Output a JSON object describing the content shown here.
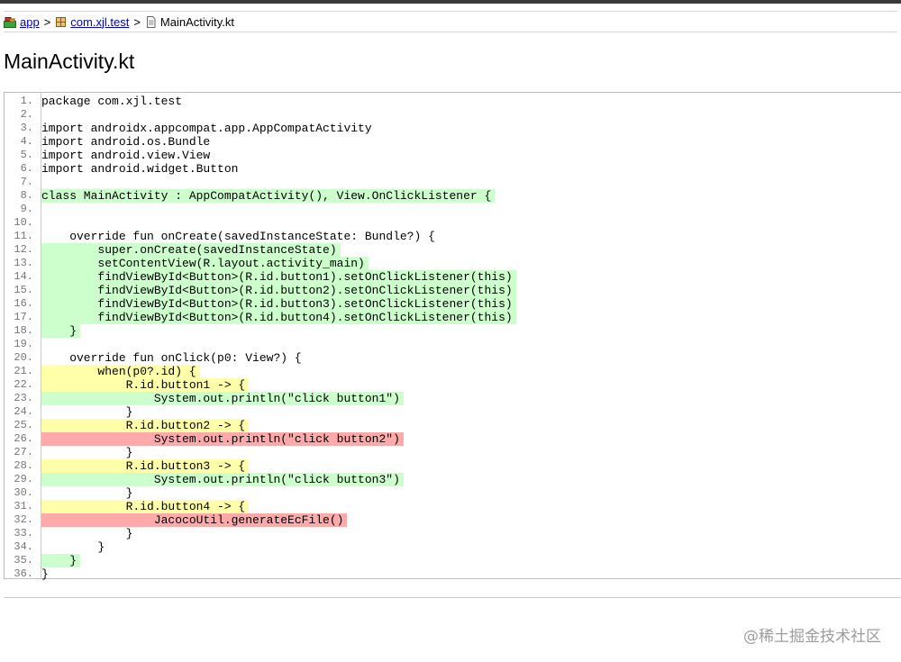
{
  "breadcrumb": {
    "items": [
      {
        "label": "app",
        "icon": "app-module-icon",
        "link": true
      },
      {
        "label": "com.xjl.test",
        "icon": "package-icon",
        "link": true
      },
      {
        "label": "MainActivity.kt",
        "icon": "source-file-icon",
        "link": false
      }
    ],
    "separator": ">"
  },
  "page": {
    "title": "MainActivity.kt"
  },
  "colors": {
    "covered": "#ccffcc",
    "partial": "#ffffaa",
    "missed": "#ffaaaa"
  },
  "source": {
    "lines": [
      {
        "n": "1.",
        "text": "package com.xjl.test",
        "cov": "",
        "branch": false
      },
      {
        "n": "2.",
        "text": "",
        "cov": "",
        "branch": false
      },
      {
        "n": "3.",
        "text": "import androidx.appcompat.app.AppCompatActivity",
        "cov": "",
        "branch": false
      },
      {
        "n": "4.",
        "text": "import android.os.Bundle",
        "cov": "",
        "branch": false
      },
      {
        "n": "5.",
        "text": "import android.view.View",
        "cov": "",
        "branch": false
      },
      {
        "n": "6.",
        "text": "import android.widget.Button",
        "cov": "",
        "branch": false
      },
      {
        "n": "7.",
        "text": "",
        "cov": "",
        "branch": false
      },
      {
        "n": "8.",
        "text": "class MainActivity : AppCompatActivity(), View.OnClickListener {",
        "cov": "fc",
        "branch": false
      },
      {
        "n": "9.",
        "text": "",
        "cov": "",
        "branch": false
      },
      {
        "n": "10.",
        "text": "",
        "cov": "",
        "branch": false
      },
      {
        "n": "11.",
        "text": "    override fun onCreate(savedInstanceState: Bundle?) {",
        "cov": "",
        "branch": false
      },
      {
        "n": "12.",
        "text": "        super.onCreate(savedInstanceState)",
        "cov": "fc",
        "branch": false
      },
      {
        "n": "13.",
        "text": "        setContentView(R.layout.activity_main)",
        "cov": "fc",
        "branch": false
      },
      {
        "n": "14.",
        "text": "        findViewById<Button>(R.id.button1).setOnClickListener(this)",
        "cov": "fc",
        "branch": false
      },
      {
        "n": "15.",
        "text": "        findViewById<Button>(R.id.button2).setOnClickListener(this)",
        "cov": "fc",
        "branch": false
      },
      {
        "n": "16.",
        "text": "        findViewById<Button>(R.id.button3).setOnClickListener(this)",
        "cov": "fc",
        "branch": false
      },
      {
        "n": "17.",
        "text": "        findViewById<Button>(R.id.button4).setOnClickListener(this)",
        "cov": "fc",
        "branch": false
      },
      {
        "n": "18.",
        "text": "    }",
        "cov": "fc",
        "branch": false
      },
      {
        "n": "19.",
        "text": "",
        "cov": "",
        "branch": false
      },
      {
        "n": "20.",
        "text": "    override fun onClick(p0: View?) {",
        "cov": "",
        "branch": false
      },
      {
        "n": "21.",
        "text": "        when(p0?.id) {",
        "cov": "pc",
        "branch": true
      },
      {
        "n": "22.",
        "text": "            R.id.button1 -> {",
        "cov": "pc",
        "branch": true
      },
      {
        "n": "23.",
        "text": "                System.out.println(\"click button1\")",
        "cov": "fc",
        "branch": false
      },
      {
        "n": "24.",
        "text": "            }",
        "cov": "",
        "branch": false
      },
      {
        "n": "25.",
        "text": "            R.id.button2 -> {",
        "cov": "pc",
        "branch": true
      },
      {
        "n": "26.",
        "text": "                System.out.println(\"click button2\")",
        "cov": "nc",
        "branch": false
      },
      {
        "n": "27.",
        "text": "            }",
        "cov": "",
        "branch": false
      },
      {
        "n": "28.",
        "text": "            R.id.button3 -> {",
        "cov": "pc",
        "branch": true
      },
      {
        "n": "29.",
        "text": "                System.out.println(\"click button3\")",
        "cov": "fc",
        "branch": false
      },
      {
        "n": "30.",
        "text": "            }",
        "cov": "",
        "branch": false
      },
      {
        "n": "31.",
        "text": "            R.id.button4 -> {",
        "cov": "pc",
        "branch": true
      },
      {
        "n": "32.",
        "text": "                JacocoUtil.generateEcFile()",
        "cov": "nc",
        "branch": false
      },
      {
        "n": "33.",
        "text": "            }",
        "cov": "",
        "branch": false
      },
      {
        "n": "34.",
        "text": "        }",
        "cov": "",
        "branch": false
      },
      {
        "n": "35.",
        "text": "    }",
        "cov": "fc",
        "branch": false
      },
      {
        "n": "36.",
        "text": "}",
        "cov": "",
        "branch": false
      }
    ]
  },
  "watermark": "@稀土掘金技术社区"
}
